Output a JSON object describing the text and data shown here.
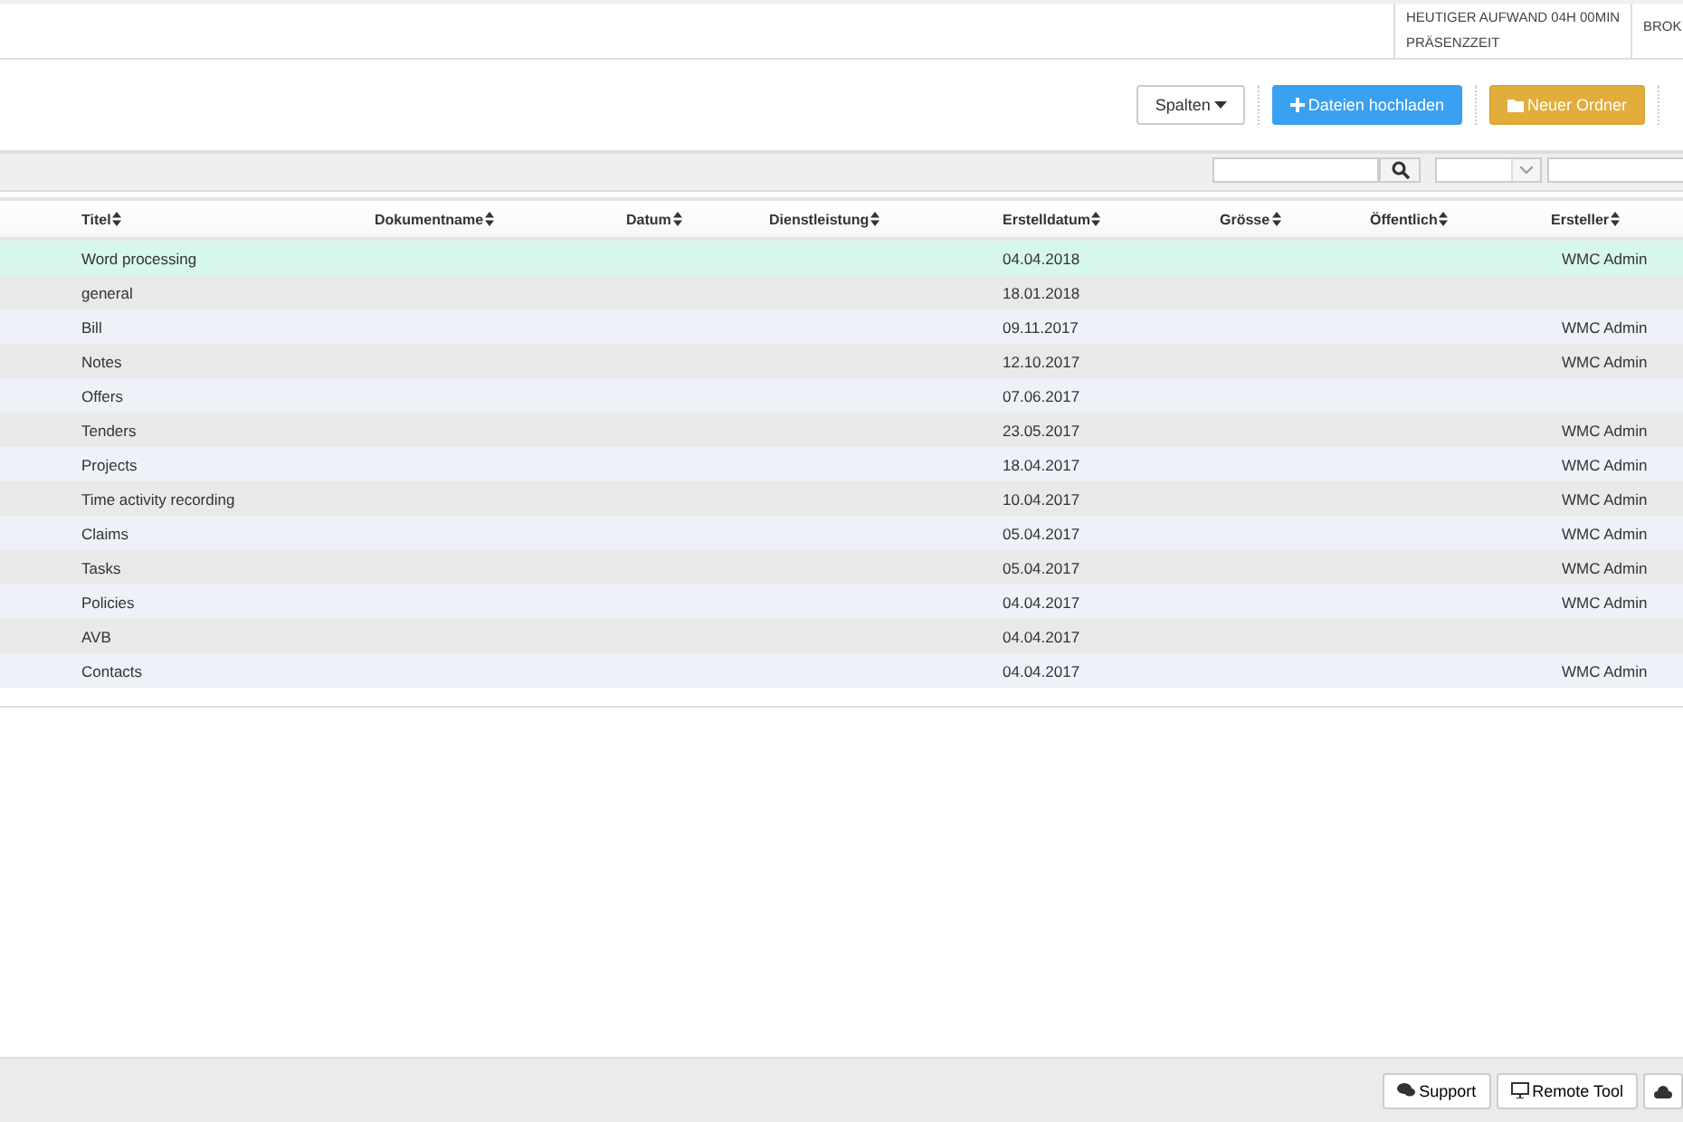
{
  "header": {
    "effort": "HEUTIGER AUFWAND 04H 00MIN",
    "presence": "PRÄSENZZEIT",
    "broker": "BROK"
  },
  "toolbar": {
    "columns_button": "Spalten",
    "upload_button": "Dateien hochladen",
    "folder_button": "Neuer Ordner"
  },
  "table": {
    "columns": [
      "Titel",
      "Dokumentname",
      "Datum",
      "Dienstleistung",
      "Erstelldatum",
      "Grösse",
      "Öffentlich",
      "Ersteller"
    ],
    "rows": [
      {
        "title": "Word processing",
        "created": "04.04.2018",
        "creator": "WMC Admin",
        "selected": true
      },
      {
        "title": "general",
        "created": "18.01.2018",
        "creator": "",
        "selected": false
      },
      {
        "title": "Bill",
        "created": "09.11.2017",
        "creator": "WMC Admin",
        "selected": false
      },
      {
        "title": "Notes",
        "created": "12.10.2017",
        "creator": "WMC Admin",
        "selected": false
      },
      {
        "title": "Offers",
        "created": "07.06.2017",
        "creator": "",
        "selected": false
      },
      {
        "title": "Tenders",
        "created": "23.05.2017",
        "creator": "WMC Admin",
        "selected": false
      },
      {
        "title": "Projects",
        "created": "18.04.2017",
        "creator": "WMC Admin",
        "selected": false
      },
      {
        "title": "Time activity recording",
        "created": "10.04.2017",
        "creator": "WMC Admin",
        "selected": false
      },
      {
        "title": "Claims",
        "created": "05.04.2017",
        "creator": "WMC Admin",
        "selected": false
      },
      {
        "title": "Tasks",
        "created": "05.04.2017",
        "creator": "WMC Admin",
        "selected": false
      },
      {
        "title": "Policies",
        "created": "04.04.2017",
        "creator": "WMC Admin",
        "selected": false
      },
      {
        "title": "AVB",
        "created": "04.04.2017",
        "creator": "",
        "selected": false
      },
      {
        "title": "Contacts",
        "created": "04.04.2017",
        "creator": "WMC Admin",
        "selected": false
      }
    ]
  },
  "footer": {
    "buttons": [
      "Support",
      "Remote Tool"
    ]
  }
}
